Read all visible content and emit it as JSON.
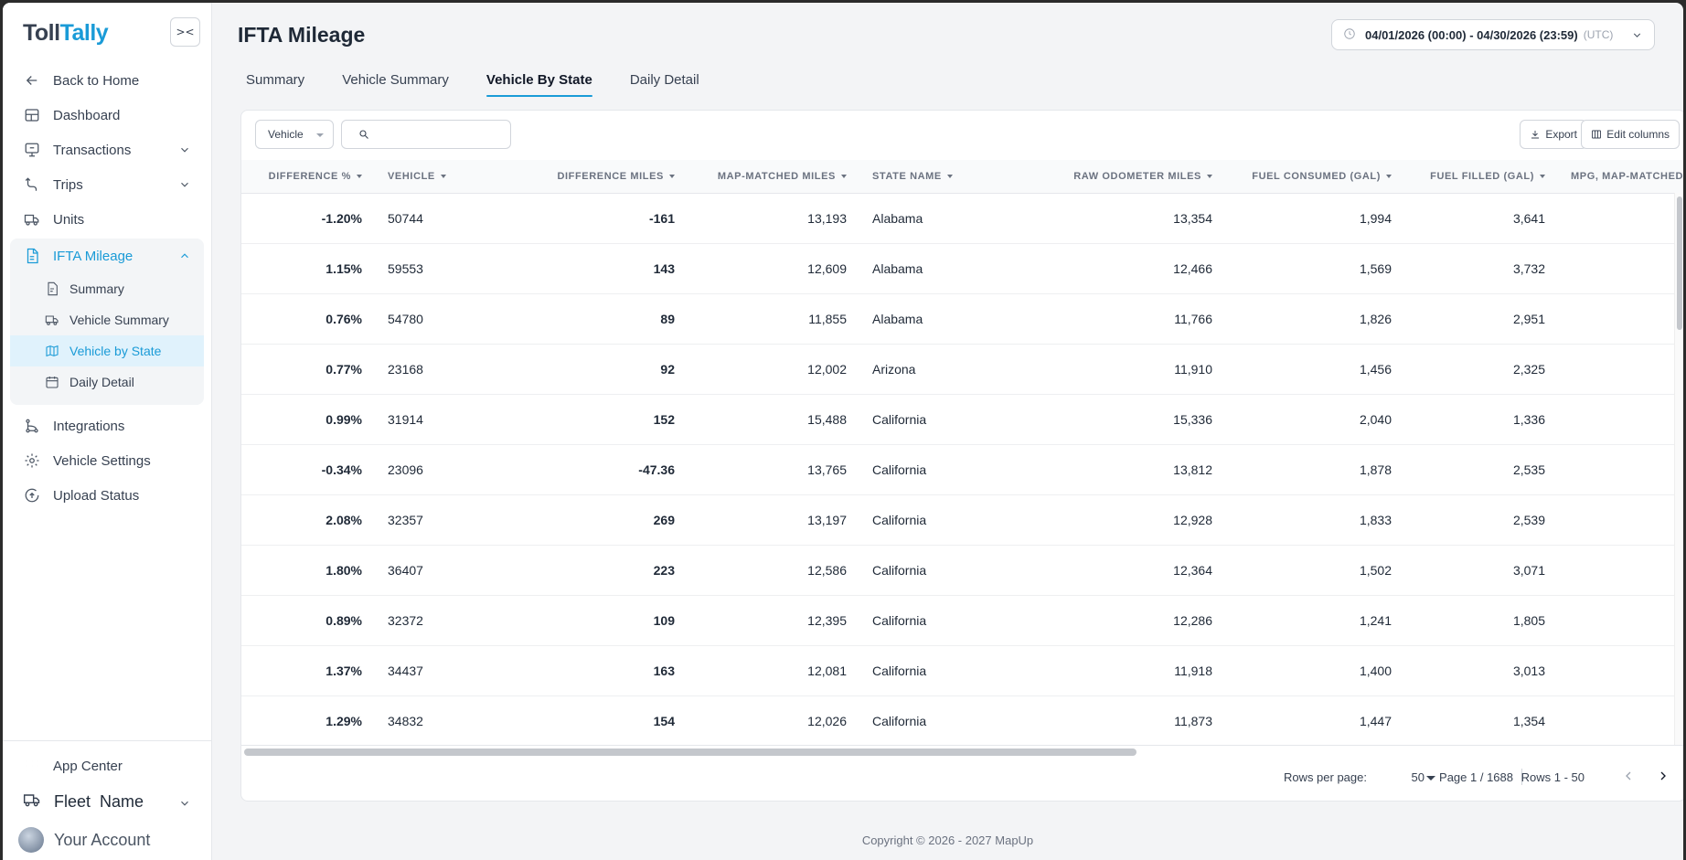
{
  "brand": {
    "logo_part1": "Toll",
    "logo_part2": "Tally"
  },
  "sidebar": {
    "collapse_label": "><",
    "items": [
      {
        "label": "Back to Home",
        "icon": "arrow-left-icon"
      },
      {
        "label": "Dashboard",
        "icon": "dashboard-icon"
      },
      {
        "label": "Transactions",
        "icon": "transactions-icon"
      },
      {
        "label": "Trips",
        "icon": "trips-icon"
      },
      {
        "label": "Units",
        "icon": "truck-icon"
      }
    ],
    "ifta": {
      "label": "IFTA Mileage",
      "children": [
        {
          "label": "Summary"
        },
        {
          "label": "Vehicle Summary"
        },
        {
          "label": "Vehicle by State"
        },
        {
          "label": "Daily Detail"
        }
      ]
    },
    "items_after": [
      {
        "label": "Integrations"
      },
      {
        "label": "Vehicle Settings"
      },
      {
        "label": "Upload Status"
      }
    ],
    "bottom": {
      "app_center": "App Center",
      "fleet_name": "Fleet  Name",
      "account": "Your Account"
    }
  },
  "header": {
    "title": "IFTA Mileage",
    "date_range": "04/01/2026 (00:00) - 04/30/2026 (23:59)",
    "timezone": "(UTC)"
  },
  "tabs": [
    {
      "label": "Summary"
    },
    {
      "label": "Vehicle Summary"
    },
    {
      "label": "Vehicle By State"
    },
    {
      "label": "Daily Detail"
    }
  ],
  "toolbar": {
    "filter_select": "Vehicle",
    "search_placeholder": "",
    "export_label": "Export",
    "edit_columns_label": "Edit columns"
  },
  "table": {
    "columns": [
      "DIFFERENCE %",
      "VEHICLE",
      "DIFFERENCE MILES",
      "MAP-MATCHED MILES",
      "STATE NAME",
      "RAW ODOMETER MILES",
      "FUEL CONSUMED (GAL)",
      "FUEL FILLED (GAL)",
      "MPG, MAP-MATCHED"
    ],
    "rows": [
      [
        "-1.20%",
        "50744",
        "-161",
        "13,193",
        "Alabama",
        "13,354",
        "1,994",
        "3,641",
        ""
      ],
      [
        "1.15%",
        "59553",
        "143",
        "12,609",
        "Alabama",
        "12,466",
        "1,569",
        "3,732",
        ""
      ],
      [
        "0.76%",
        "54780",
        "89",
        "11,855",
        "Alabama",
        "11,766",
        "1,826",
        "2,951",
        ""
      ],
      [
        "0.77%",
        "23168",
        "92",
        "12,002",
        "Arizona",
        "11,910",
        "1,456",
        "2,325",
        ""
      ],
      [
        "0.99%",
        "31914",
        "152",
        "15,488",
        "California",
        "15,336",
        "2,040",
        "1,336",
        ""
      ],
      [
        "-0.34%",
        "23096",
        "-47.36",
        "13,765",
        "California",
        "13,812",
        "1,878",
        "2,535",
        ""
      ],
      [
        "2.08%",
        "32357",
        "269",
        "13,197",
        "California",
        "12,928",
        "1,833",
        "2,539",
        ""
      ],
      [
        "1.80%",
        "36407",
        "223",
        "12,586",
        "California",
        "12,364",
        "1,502",
        "3,071",
        ""
      ],
      [
        "0.89%",
        "32372",
        "109",
        "12,395",
        "California",
        "12,286",
        "1,241",
        "1,805",
        ""
      ],
      [
        "1.37%",
        "34437",
        "163",
        "12,081",
        "California",
        "11,918",
        "1,400",
        "3,013",
        ""
      ],
      [
        "1.29%",
        "34832",
        "154",
        "12,026",
        "California",
        "11,873",
        "1,447",
        "1,354",
        ""
      ],
      [
        "",
        "",
        "",
        "",
        "",
        "",
        "",
        "",
        ""
      ]
    ]
  },
  "pagination": {
    "rows_per_page_label": "Rows per page:",
    "rows_per_page": "50",
    "page": "Page 1 / 1688",
    "rows": "Rows 1 - 50"
  },
  "footer": {
    "copyright": "Copyright © 2026 - 2027 MapUp"
  },
  "colors": {
    "accent": "#1a9bd7"
  }
}
